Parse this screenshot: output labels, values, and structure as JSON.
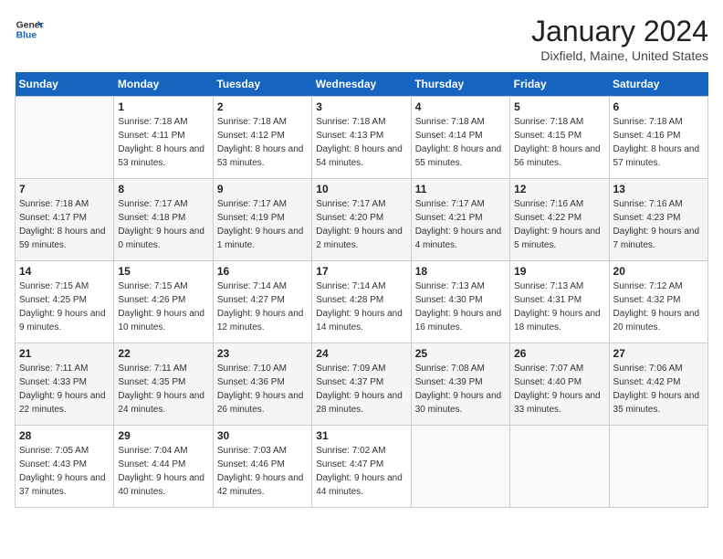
{
  "logo": {
    "general": "General",
    "blue": "Blue"
  },
  "header": {
    "month": "January 2024",
    "location": "Dixfield, Maine, United States"
  },
  "weekdays": [
    "Sunday",
    "Monday",
    "Tuesday",
    "Wednesday",
    "Thursday",
    "Friday",
    "Saturday"
  ],
  "weeks": [
    [
      {
        "day": "",
        "sunrise": "",
        "sunset": "",
        "daylight": ""
      },
      {
        "day": "1",
        "sunrise": "Sunrise: 7:18 AM",
        "sunset": "Sunset: 4:11 PM",
        "daylight": "Daylight: 8 hours and 53 minutes."
      },
      {
        "day": "2",
        "sunrise": "Sunrise: 7:18 AM",
        "sunset": "Sunset: 4:12 PM",
        "daylight": "Daylight: 8 hours and 53 minutes."
      },
      {
        "day": "3",
        "sunrise": "Sunrise: 7:18 AM",
        "sunset": "Sunset: 4:13 PM",
        "daylight": "Daylight: 8 hours and 54 minutes."
      },
      {
        "day": "4",
        "sunrise": "Sunrise: 7:18 AM",
        "sunset": "Sunset: 4:14 PM",
        "daylight": "Daylight: 8 hours and 55 minutes."
      },
      {
        "day": "5",
        "sunrise": "Sunrise: 7:18 AM",
        "sunset": "Sunset: 4:15 PM",
        "daylight": "Daylight: 8 hours and 56 minutes."
      },
      {
        "day": "6",
        "sunrise": "Sunrise: 7:18 AM",
        "sunset": "Sunset: 4:16 PM",
        "daylight": "Daylight: 8 hours and 57 minutes."
      }
    ],
    [
      {
        "day": "7",
        "sunrise": "Sunrise: 7:18 AM",
        "sunset": "Sunset: 4:17 PM",
        "daylight": "Daylight: 8 hours and 59 minutes."
      },
      {
        "day": "8",
        "sunrise": "Sunrise: 7:17 AM",
        "sunset": "Sunset: 4:18 PM",
        "daylight": "Daylight: 9 hours and 0 minutes."
      },
      {
        "day": "9",
        "sunrise": "Sunrise: 7:17 AM",
        "sunset": "Sunset: 4:19 PM",
        "daylight": "Daylight: 9 hours and 1 minute."
      },
      {
        "day": "10",
        "sunrise": "Sunrise: 7:17 AM",
        "sunset": "Sunset: 4:20 PM",
        "daylight": "Daylight: 9 hours and 2 minutes."
      },
      {
        "day": "11",
        "sunrise": "Sunrise: 7:17 AM",
        "sunset": "Sunset: 4:21 PM",
        "daylight": "Daylight: 9 hours and 4 minutes."
      },
      {
        "day": "12",
        "sunrise": "Sunrise: 7:16 AM",
        "sunset": "Sunset: 4:22 PM",
        "daylight": "Daylight: 9 hours and 5 minutes."
      },
      {
        "day": "13",
        "sunrise": "Sunrise: 7:16 AM",
        "sunset": "Sunset: 4:23 PM",
        "daylight": "Daylight: 9 hours and 7 minutes."
      }
    ],
    [
      {
        "day": "14",
        "sunrise": "Sunrise: 7:15 AM",
        "sunset": "Sunset: 4:25 PM",
        "daylight": "Daylight: 9 hours and 9 minutes."
      },
      {
        "day": "15",
        "sunrise": "Sunrise: 7:15 AM",
        "sunset": "Sunset: 4:26 PM",
        "daylight": "Daylight: 9 hours and 10 minutes."
      },
      {
        "day": "16",
        "sunrise": "Sunrise: 7:14 AM",
        "sunset": "Sunset: 4:27 PM",
        "daylight": "Daylight: 9 hours and 12 minutes."
      },
      {
        "day": "17",
        "sunrise": "Sunrise: 7:14 AM",
        "sunset": "Sunset: 4:28 PM",
        "daylight": "Daylight: 9 hours and 14 minutes."
      },
      {
        "day": "18",
        "sunrise": "Sunrise: 7:13 AM",
        "sunset": "Sunset: 4:30 PM",
        "daylight": "Daylight: 9 hours and 16 minutes."
      },
      {
        "day": "19",
        "sunrise": "Sunrise: 7:13 AM",
        "sunset": "Sunset: 4:31 PM",
        "daylight": "Daylight: 9 hours and 18 minutes."
      },
      {
        "day": "20",
        "sunrise": "Sunrise: 7:12 AM",
        "sunset": "Sunset: 4:32 PM",
        "daylight": "Daylight: 9 hours and 20 minutes."
      }
    ],
    [
      {
        "day": "21",
        "sunrise": "Sunrise: 7:11 AM",
        "sunset": "Sunset: 4:33 PM",
        "daylight": "Daylight: 9 hours and 22 minutes."
      },
      {
        "day": "22",
        "sunrise": "Sunrise: 7:11 AM",
        "sunset": "Sunset: 4:35 PM",
        "daylight": "Daylight: 9 hours and 24 minutes."
      },
      {
        "day": "23",
        "sunrise": "Sunrise: 7:10 AM",
        "sunset": "Sunset: 4:36 PM",
        "daylight": "Daylight: 9 hours and 26 minutes."
      },
      {
        "day": "24",
        "sunrise": "Sunrise: 7:09 AM",
        "sunset": "Sunset: 4:37 PM",
        "daylight": "Daylight: 9 hours and 28 minutes."
      },
      {
        "day": "25",
        "sunrise": "Sunrise: 7:08 AM",
        "sunset": "Sunset: 4:39 PM",
        "daylight": "Daylight: 9 hours and 30 minutes."
      },
      {
        "day": "26",
        "sunrise": "Sunrise: 7:07 AM",
        "sunset": "Sunset: 4:40 PM",
        "daylight": "Daylight: 9 hours and 33 minutes."
      },
      {
        "day": "27",
        "sunrise": "Sunrise: 7:06 AM",
        "sunset": "Sunset: 4:42 PM",
        "daylight": "Daylight: 9 hours and 35 minutes."
      }
    ],
    [
      {
        "day": "28",
        "sunrise": "Sunrise: 7:05 AM",
        "sunset": "Sunset: 4:43 PM",
        "daylight": "Daylight: 9 hours and 37 minutes."
      },
      {
        "day": "29",
        "sunrise": "Sunrise: 7:04 AM",
        "sunset": "Sunset: 4:44 PM",
        "daylight": "Daylight: 9 hours and 40 minutes."
      },
      {
        "day": "30",
        "sunrise": "Sunrise: 7:03 AM",
        "sunset": "Sunset: 4:46 PM",
        "daylight": "Daylight: 9 hours and 42 minutes."
      },
      {
        "day": "31",
        "sunrise": "Sunrise: 7:02 AM",
        "sunset": "Sunset: 4:47 PM",
        "daylight": "Daylight: 9 hours and 44 minutes."
      },
      {
        "day": "",
        "sunrise": "",
        "sunset": "",
        "daylight": ""
      },
      {
        "day": "",
        "sunrise": "",
        "sunset": "",
        "daylight": ""
      },
      {
        "day": "",
        "sunrise": "",
        "sunset": "",
        "daylight": ""
      }
    ]
  ]
}
